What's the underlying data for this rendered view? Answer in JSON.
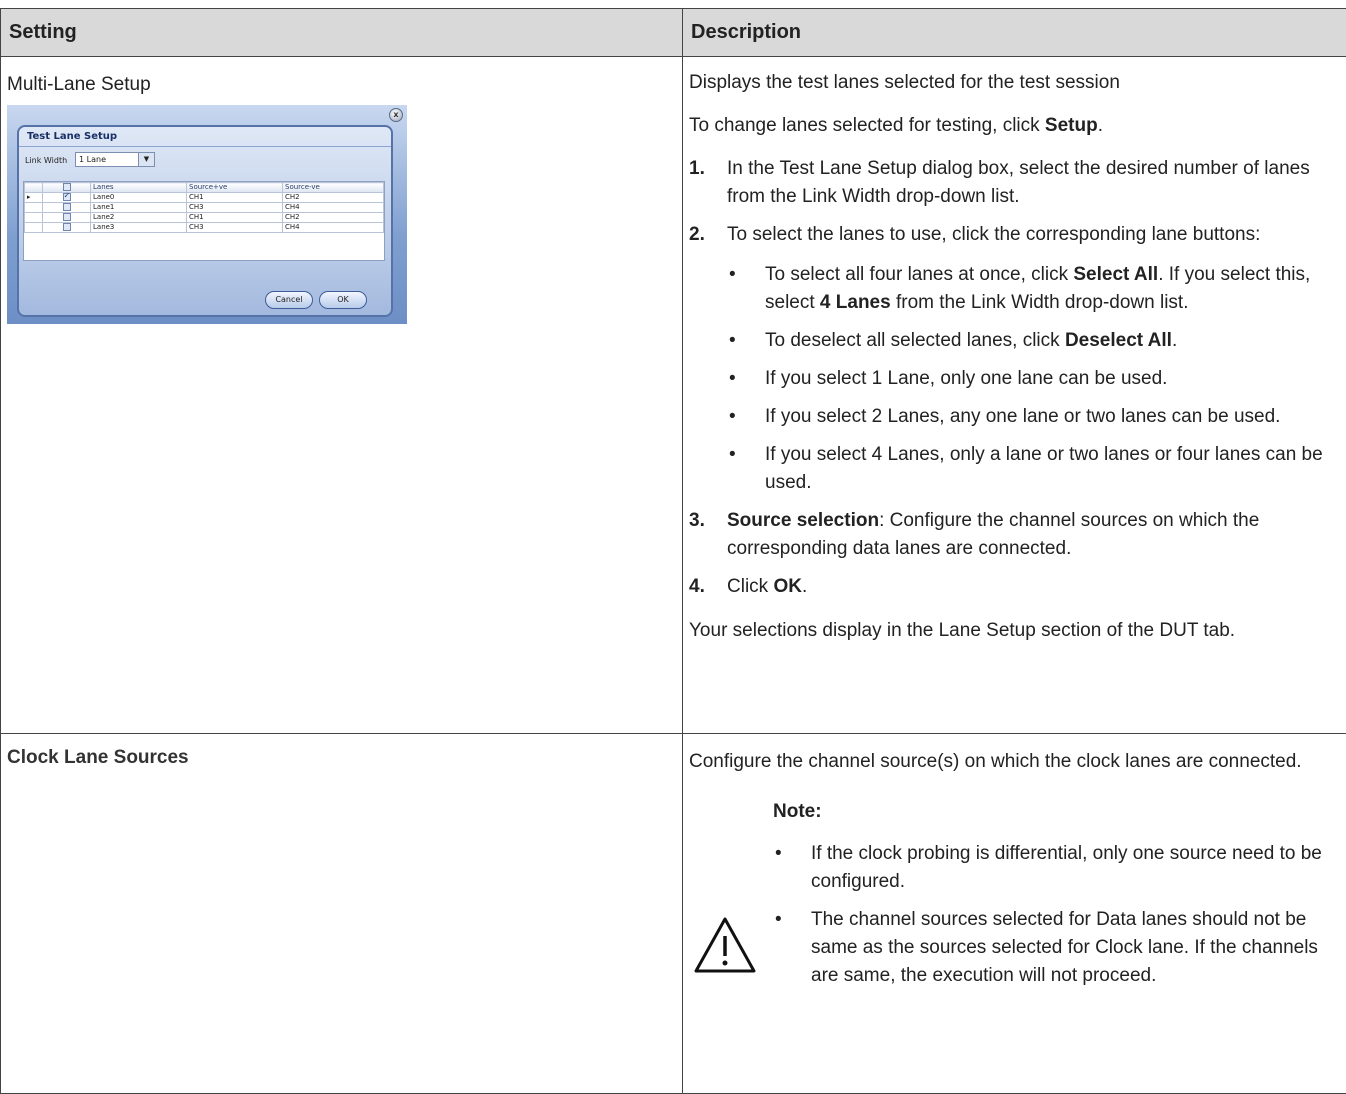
{
  "table": {
    "header": {
      "setting": "Setting",
      "description": "Description"
    },
    "multi_lane": {
      "setting": "Multi-Lane Setup",
      "intro": "Displays the test lanes selected for the test session",
      "change_prefix": "To change lanes selected for testing, click ",
      "change_bold": "Setup",
      "change_suffix": ".",
      "steps": [
        {
          "num": "1.",
          "text": "In the Test Lane Setup dialog box, select the desired number of lanes from the Link Width drop-down list."
        },
        {
          "num": "2.",
          "text": "To select the lanes to use, click the corresponding lane buttons:"
        },
        {
          "num": "3.",
          "bold": "Source selection",
          "text": ": Configure the channel sources on which the corresponding data lanes are connected."
        },
        {
          "num": "4.",
          "prefix": "Click ",
          "bold": "OK",
          "suffix": "."
        }
      ],
      "bullets": [
        {
          "prefix": "To select all four lanes at once, click ",
          "bold": "Select All",
          "mid": ". If you select this, select ",
          "bold2": "4 Lanes",
          "suffix": " from the Link Width drop-down list."
        },
        {
          "prefix": "To deselect all selected lanes, click ",
          "bold": "Deselect All",
          "suffix": "."
        },
        {
          "text": "If you select 1 Lane, only one lane can be used."
        },
        {
          "text": "If you select 2 Lanes, any one lane or two lanes can be used."
        },
        {
          "text": "If you select 4 Lanes, only a lane or two lanes or four lanes can be used."
        }
      ],
      "bullet_glyph": "•",
      "closing": "Your selections display in the Lane Setup section of the DUT tab."
    },
    "clock": {
      "setting": "Clock Lane Sources",
      "description": "Configure the channel source(s) on which the clock lanes are connected.",
      "note_label": "Note:",
      "notes": [
        "If the clock probing is differential, only one source need to be configured.",
        "The channel sources selected for Data lanes should not be same as the sources selected for Clock lane. If the channels are same, the execution will not proceed."
      ],
      "icon": "warning-icon"
    }
  },
  "dialog": {
    "title": "Test Lane Setup",
    "close_glyph": "x",
    "link_width_label": "Link Width",
    "link_width_value": "1 Lane",
    "dropdown_glyph": "▼",
    "row_indicator_glyph": "▸",
    "columns": [
      "Lanes",
      "Source+ve",
      "Source-ve"
    ],
    "rows": [
      {
        "checked": true,
        "lane": "Lane0",
        "src_pos": "CH1",
        "src_neg": "CH2"
      },
      {
        "checked": false,
        "lane": "Lane1",
        "src_pos": "CH3",
        "src_neg": "CH4"
      },
      {
        "checked": false,
        "lane": "Lane2",
        "src_pos": "CH1",
        "src_neg": "CH2"
      },
      {
        "checked": false,
        "lane": "Lane3",
        "src_pos": "CH3",
        "src_neg": "CH4"
      }
    ],
    "cancel_label": "Cancel",
    "ok_label": "OK"
  }
}
